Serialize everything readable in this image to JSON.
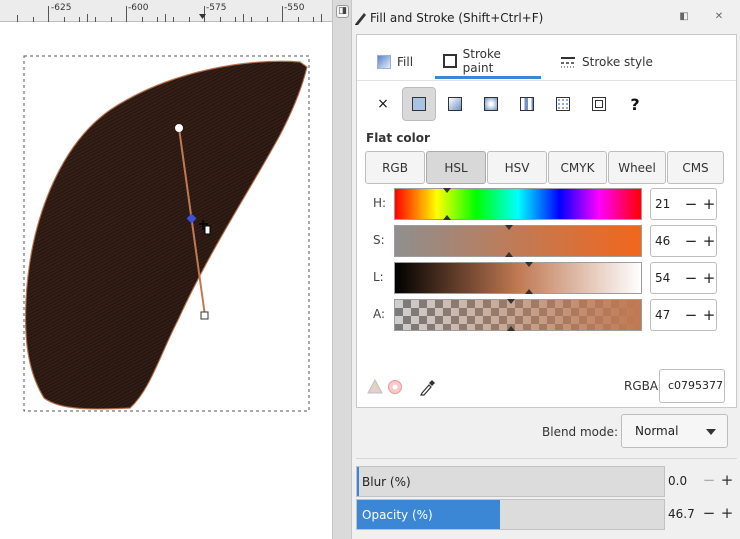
{
  "ruler": {
    "labels": [
      "-625",
      "-600",
      "-575",
      "-550"
    ]
  },
  "dialog": {
    "title": "Fill and Stroke (Shift+Ctrl+F)",
    "tabs": [
      {
        "label": "Fill",
        "icon": "fill-icon"
      },
      {
        "label": "Stroke paint",
        "icon": "stroke-paint-icon"
      },
      {
        "label": "Stroke style",
        "icon": "stroke-style-icon"
      }
    ],
    "active_tab": "Stroke paint",
    "paint_types": [
      "none",
      "flat-color",
      "linear-gradient",
      "radial-gradient",
      "mesh-gradient",
      "pattern",
      "swatch",
      "unset"
    ],
    "unset_label": "?",
    "none_label": "×",
    "flat_color_label": "Flat color",
    "color_modes": [
      "RGB",
      "HSL",
      "HSV",
      "CMYK",
      "Wheel",
      "CMS"
    ],
    "active_mode": "HSL",
    "channels": [
      {
        "label": "H:",
        "value": "21"
      },
      {
        "label": "S:",
        "value": "46"
      },
      {
        "label": "L:",
        "value": "54"
      },
      {
        "label": "A:",
        "value": "47"
      }
    ],
    "rgba_label": "RGBA:",
    "rgba_value": "c0795377",
    "blend_label": "Blend mode:",
    "blend_value": "Normal",
    "blur": {
      "label": "Blur (%)",
      "value": "0.0",
      "fraction": 0.0
    },
    "opacity": {
      "label": "Opacity (%)",
      "value": "46.7",
      "fraction": 0.467
    },
    "colors": {
      "accent": "#3c86d6",
      "stroke_color": "#c07953",
      "shape_fill": "#3a2219"
    }
  }
}
